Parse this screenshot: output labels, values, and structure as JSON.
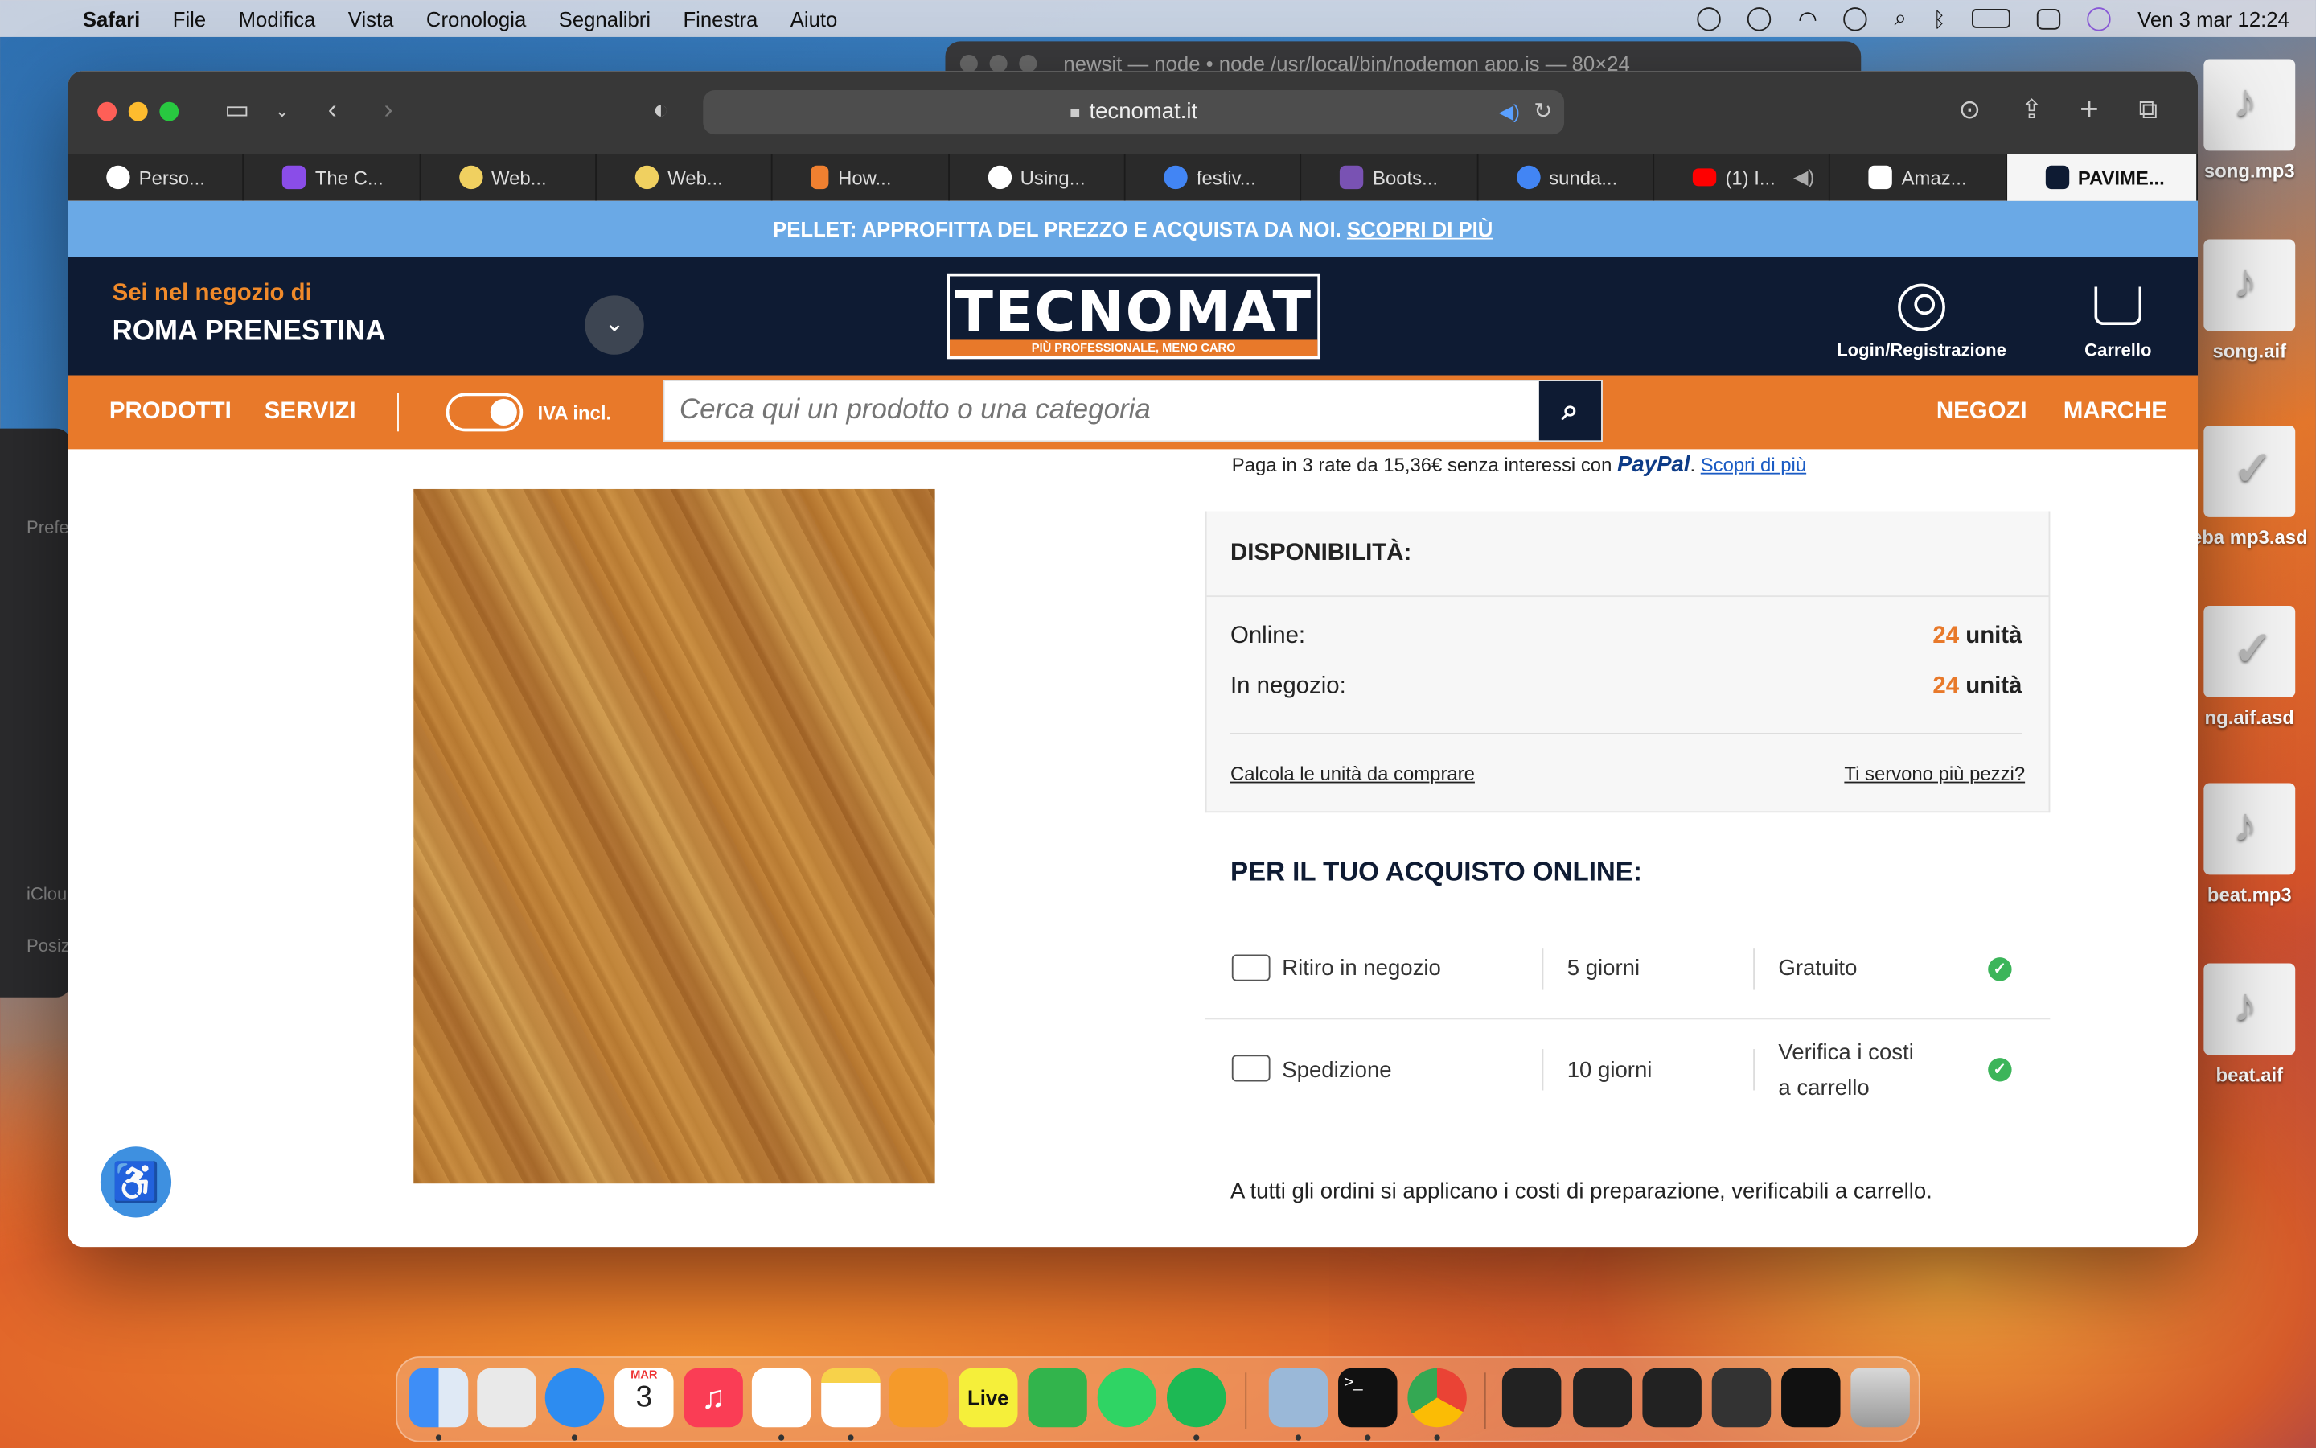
{
  "menubar": {
    "app": "Safari",
    "items": [
      "File",
      "Modifica",
      "Vista",
      "Cronologia",
      "Segnalibri",
      "Finestra",
      "Aiuto"
    ],
    "datetime": "Ven 3 mar  12:24"
  },
  "terminal_title": "newsit — node • node /usr/local/bin/nodemon app.js — 80×24",
  "desktop_files": [
    "song.mp3",
    "song.aif",
    "eba mp3.asd",
    "ng.aif.asd",
    "beat.mp3",
    "beat.aif"
  ],
  "left_window": {
    "labels": [
      "Prefe",
      "iClou",
      "Posiz"
    ]
  },
  "browser": {
    "url": "tecnomat.it",
    "tabs": [
      {
        "label": "Perso...",
        "fav_color": "#ffffff"
      },
      {
        "label": "The C...",
        "fav_color": "#8a4de8"
      },
      {
        "label": "Web...",
        "fav_color": "#f0d060"
      },
      {
        "label": "Web...",
        "fav_color": "#f0d060"
      },
      {
        "label": "How...",
        "fav_color": "#f08030"
      },
      {
        "label": "Using...",
        "fav_color": "#ffffff"
      },
      {
        "label": "festiv...",
        "fav_color": "#4285f4"
      },
      {
        "label": "Boots...",
        "fav_color": "#7952b3"
      },
      {
        "label": "sunda...",
        "fav_color": "#4285f4"
      },
      {
        "label": "(1) I...",
        "fav_color": "#ff0000"
      },
      {
        "label": "Amaz...",
        "fav_color": "#ffffff"
      },
      {
        "label": "PAVIME...",
        "fav_color": "#0e1b33"
      }
    ]
  },
  "site": {
    "promo_text": "PELLET: APPROFITTA DEL PREZZO E ACQUISTA DA NOI.",
    "promo_link": "SCOPRI DI PIÙ",
    "store_label": "Sei nel negozio di",
    "store_name": "ROMA PRENESTINA",
    "logo_word": "TECNOMAT",
    "logo_tagline": "PIÙ PROFESSIONALE, MENO CARO",
    "login_label": "Login/Registrazione",
    "cart_label": "Carrello",
    "nav": {
      "prodotti": "PRODOTTI",
      "servizi": "SERVIZI",
      "iva": "IVA incl.",
      "negozi": "NEGOZI",
      "marche": "MARCHE"
    },
    "search_placeholder": "Cerca qui un prodotto o una categoria"
  },
  "product": {
    "paypal_text": "Paga in 3 rate da 15,36€ senza interessi con",
    "paypal_brand": "PayPal",
    "paypal_link": "Scopri di più",
    "availability_title": "DISPONIBILITÀ:",
    "online_label": "Online:",
    "online_qty": "24",
    "store_label": "In negozio:",
    "store_qty": "24",
    "unit_word": "unità",
    "calc_link": "Calcola le unità da comprare",
    "more_link": "Ti servono più pezzi?",
    "purchase_title": "PER IL TUO ACQUISTO ONLINE:",
    "pickup": {
      "label": "Ritiro in negozio",
      "time": "5 giorni",
      "cost": "Gratuito"
    },
    "shipping": {
      "label": "Spedizione",
      "time": "10 giorni",
      "cost_line1": "Verifica i costi",
      "cost_line2": "a carrello"
    },
    "footnote": "A tutti gli ordini si applicano i costi di preparazione, verificabili a carrello."
  },
  "dock": {
    "calendar_month": "MAR",
    "calendar_day": "3",
    "live_label": "Live"
  },
  "colors": {
    "brand_navy": "#0e1b33",
    "brand_orange": "#e8792a",
    "promo_blue": "#6aa9e6",
    "ok_green": "#3cb55a"
  }
}
